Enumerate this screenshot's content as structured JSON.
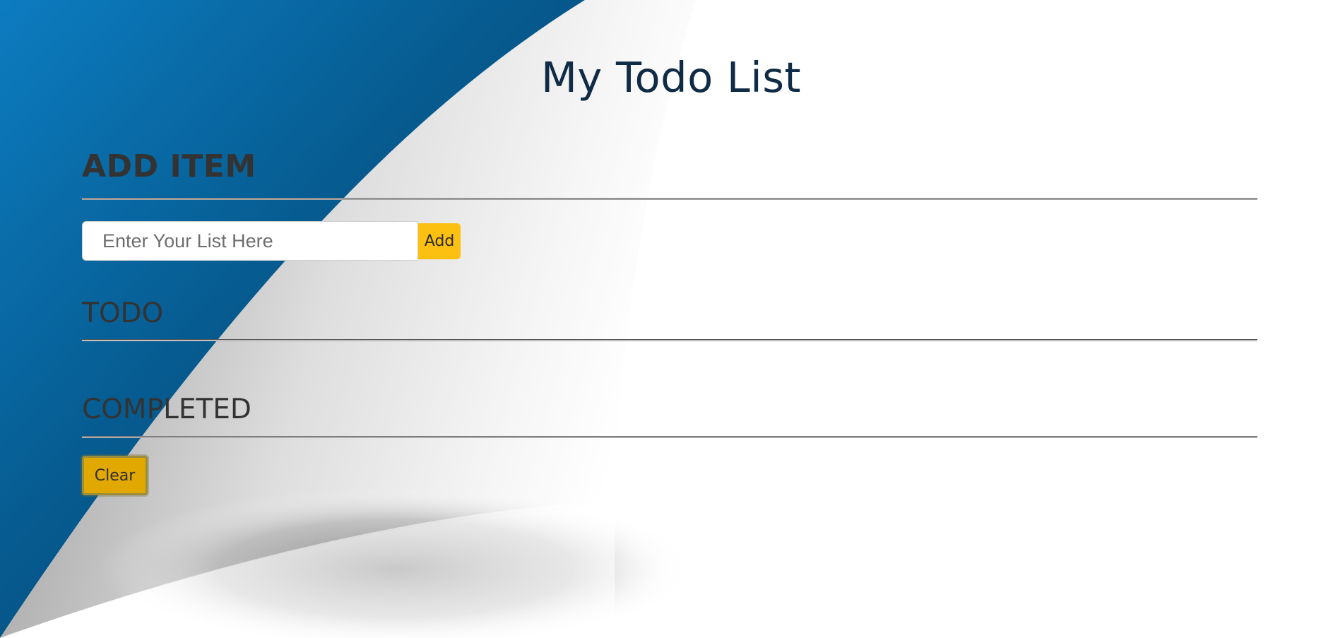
{
  "header": {
    "title": "My Todo List"
  },
  "add_section": {
    "heading": "ADD ITEM",
    "input_placeholder": "Enter Your List Here",
    "input_value": "",
    "add_label": "Add"
  },
  "todo_section": {
    "heading": "TODO",
    "items": []
  },
  "completed_section": {
    "heading": "COMPLETED",
    "items": [],
    "clear_label": "Clear"
  },
  "colors": {
    "title": "#0f2b45",
    "heading": "#333333",
    "button": "#fcc010",
    "clear_button": "#e0a800",
    "background_blue": "#0a6fad",
    "background_white": "#ffffff"
  }
}
